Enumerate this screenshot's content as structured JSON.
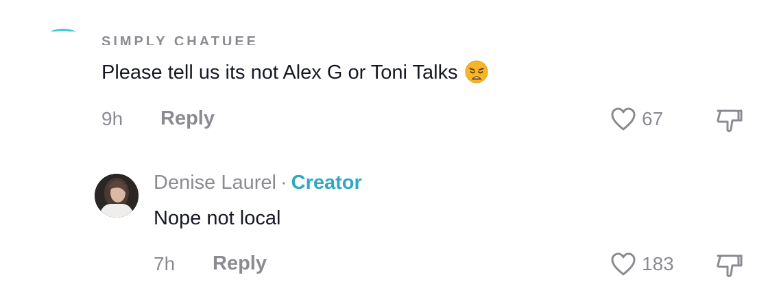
{
  "comment": {
    "username": "SIMPLY CHATUEE",
    "text": "Please tell us its not Alex G or Toni Talks",
    "emoji": "weary-face-emoji",
    "time": "9h",
    "reply_label": "Reply",
    "likes": "67"
  },
  "reply": {
    "author": "Denise Laurel",
    "separator": "·",
    "badge": "Creator",
    "text": "Nope not local",
    "time": "7h",
    "reply_label": "Reply",
    "likes": "183"
  },
  "colors": {
    "text": "#161823",
    "muted": "#8a8b91",
    "creator_badge": "#2fa8c0",
    "avatar_ring": "#3cc7d6"
  },
  "icons": [
    "heart-outline-icon",
    "dislike-icon",
    "weary-face-emoji"
  ]
}
